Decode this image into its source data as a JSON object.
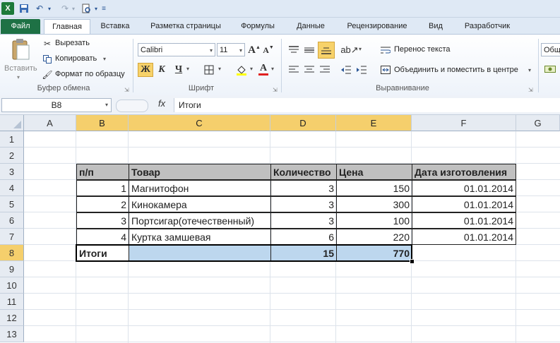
{
  "quick_access": {
    "app_icon": "excel-icon",
    "save": "save-icon",
    "undo": "undo-icon",
    "redo": "redo-icon",
    "preview": "print-preview-icon"
  },
  "tabs": [
    "Файл",
    "Главная",
    "Вставка",
    "Разметка страницы",
    "Формулы",
    "Данные",
    "Рецензирование",
    "Вид",
    "Разработчик"
  ],
  "clipboard": {
    "paste": "Вставить",
    "cut": "Вырезать",
    "copy": "Копировать",
    "format_painter": "Формат по образцу",
    "group_label": "Буфер обмена"
  },
  "font": {
    "name": "Calibri",
    "size": "11",
    "bold": "Ж",
    "italic": "К",
    "underline": "Ч",
    "grow": "A",
    "shrink": "A",
    "group_label": "Шрифт"
  },
  "alignment": {
    "wrap": "Перенос текста",
    "merge": "Объединить и поместить в центре",
    "group_label": "Выравнивание"
  },
  "number_format": "Общ",
  "name_box": "B8",
  "formula_label": "fx",
  "formula": "Итоги",
  "columns": [
    "A",
    "B",
    "C",
    "D",
    "E",
    "F",
    "G"
  ],
  "rows": [
    "1",
    "2",
    "3",
    "4",
    "5",
    "6",
    "7",
    "8",
    "9",
    "10",
    "11",
    "12",
    "13"
  ],
  "table": {
    "headers": [
      "п/п",
      "Товар",
      "Количество",
      "Цена",
      "Дата изготовления"
    ],
    "rows": [
      [
        "1",
        "Магнитофон",
        "3",
        "150",
        "01.01.2014"
      ],
      [
        "2",
        "Кинокамера",
        "3",
        "300",
        "01.01.2014"
      ],
      [
        "3",
        "Портсигар(отечественный)",
        "3",
        "100",
        "01.01.2014"
      ],
      [
        "4",
        "Куртка замшевая",
        "6",
        "220",
        "01.01.2014"
      ]
    ],
    "totals": {
      "label": "Итоги",
      "quantity": "15",
      "price": "770"
    }
  },
  "colors": {
    "file_tab": "#1e7145",
    "selection_header": "#f5cf6c",
    "total_fill": "#bdd7ee",
    "header_fill": "#c0c0c0"
  }
}
